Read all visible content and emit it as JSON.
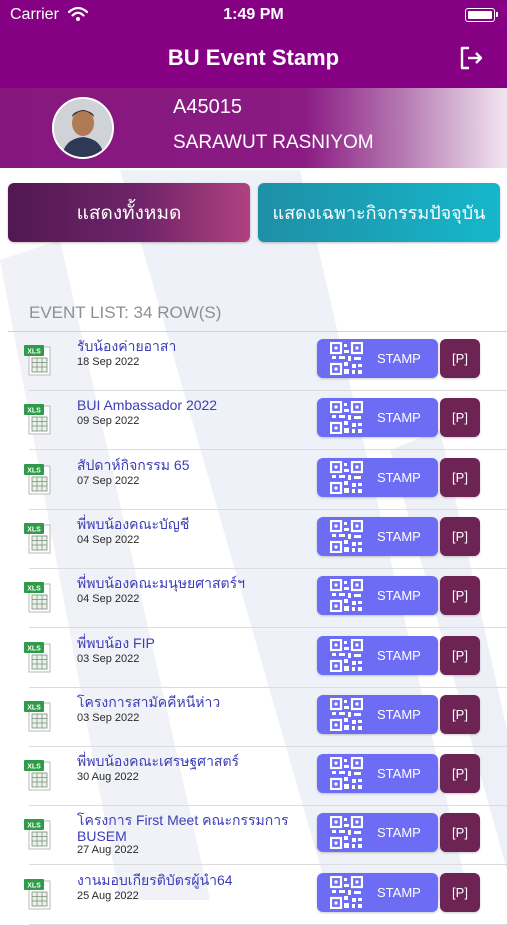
{
  "status_bar": {
    "carrier": "Carrier",
    "time": "1:49 PM"
  },
  "nav": {
    "title": "BU Event Stamp",
    "logout_icon": "logout-icon"
  },
  "profile": {
    "id": "A45015",
    "name": "SARAWUT RASNIYOM"
  },
  "filters": {
    "show_all": "แสดงทั้งหมด",
    "show_current": "แสดงเฉพาะกิจกรรมปัจจุบัน"
  },
  "list_header": "EVENT LIST: 34 ROW(S)",
  "stamp_label": "STAMP",
  "p_label": "[P]",
  "events": [
    {
      "title": "รับน้องค่ายอาสา",
      "date": "18 Sep 2022"
    },
    {
      "title": "BUI Ambassador 2022",
      "date": "09 Sep 2022"
    },
    {
      "title": "สัปดาห์กิจกรรม 65",
      "date": "07 Sep 2022"
    },
    {
      "title": "พี่พบน้องคณะบัญชี",
      "date": "04 Sep 2022"
    },
    {
      "title": "พี่พบน้องคณะมนุษยศาสตร์ฯ",
      "date": "04 Sep 2022"
    },
    {
      "title": "พี่พบน้อง FIP",
      "date": "03 Sep 2022"
    },
    {
      "title": "โครงการสามัคคีหนีห่าว",
      "date": "03 Sep 2022"
    },
    {
      "title": "พี่พบน้องคณะเศรษฐศาสตร์",
      "date": "30 Aug 2022"
    },
    {
      "title": "โครงการ First Meet คณะกรรมการ BUSEM",
      "date": "27 Aug 2022"
    },
    {
      "title": "งานมอบเกียรติบัตรผู้นำ64",
      "date": "25 Aug 2022"
    }
  ],
  "colors": {
    "header": "#860084",
    "stamp_button": "#6d6cf4",
    "p_button": "#6e2355",
    "current_button": "#16b7cb",
    "event_title": "#3d3db8"
  }
}
